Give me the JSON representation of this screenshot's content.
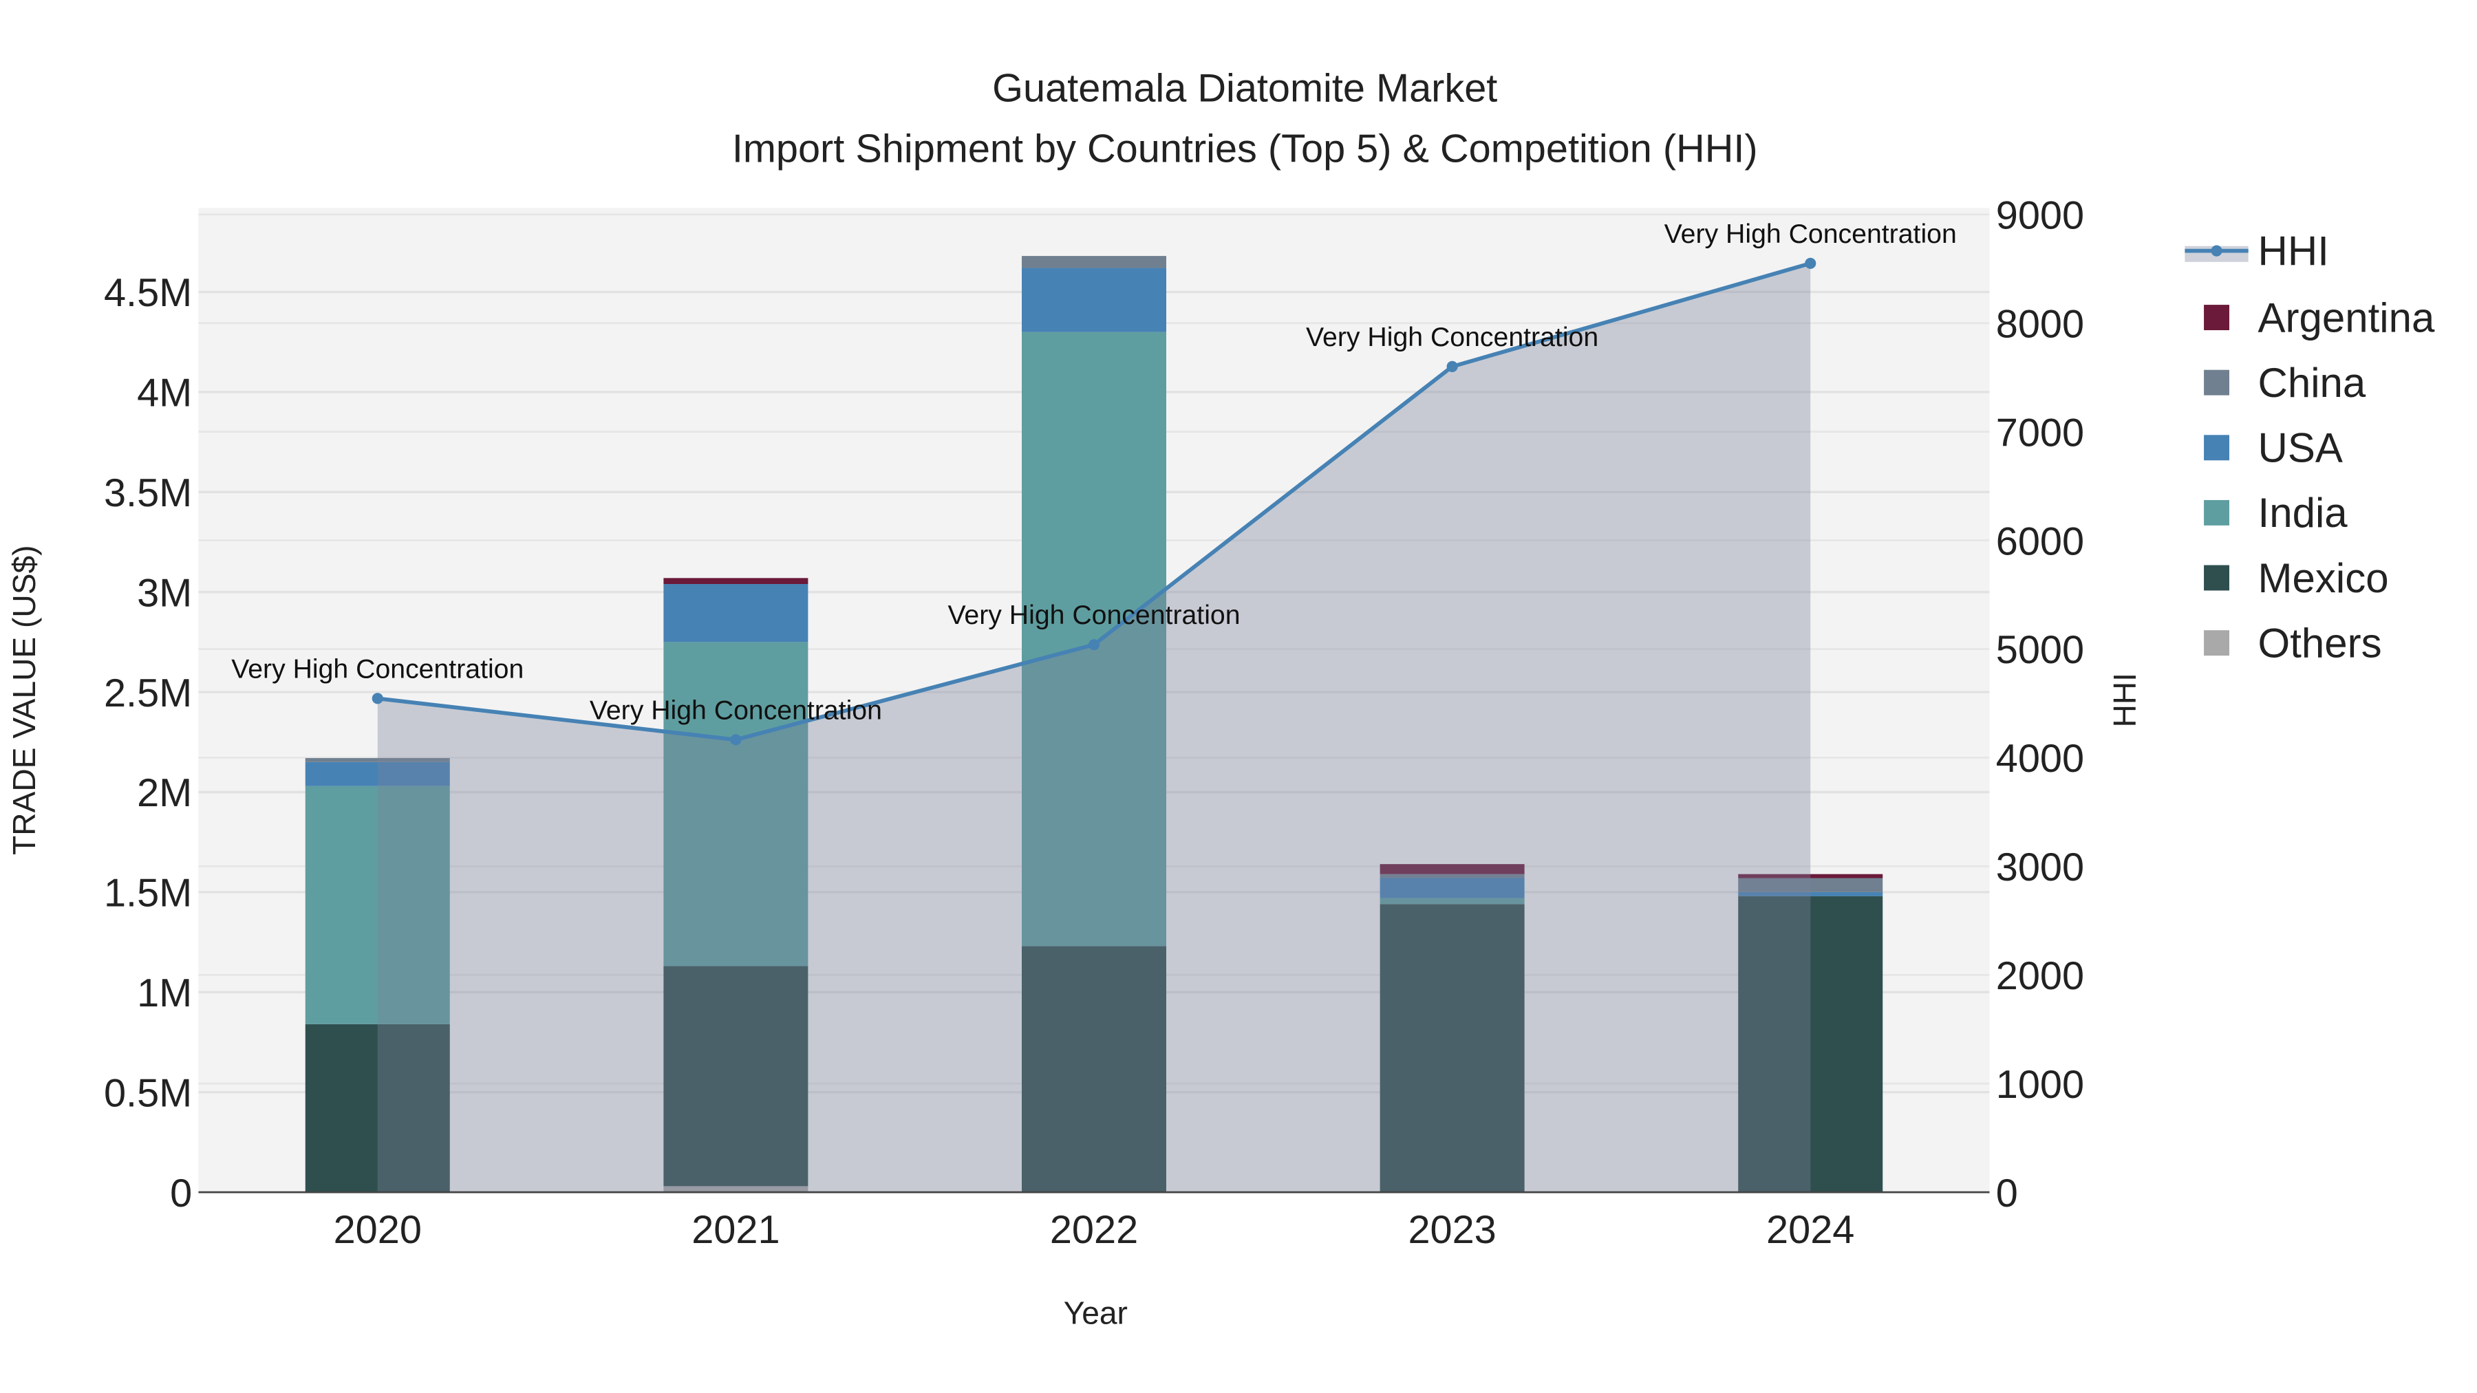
{
  "chart_data": {
    "type": "bar",
    "title_line1": "Guatemala Diatomite Market",
    "title_line2": "Import Shipment by Countries (Top 5) & Competition (HHI)",
    "xlabel": "Year",
    "ylabel": "TRADE VALUE (US$)",
    "y2label": "HHI",
    "categories": [
      "2020",
      "2021",
      "2022",
      "2023",
      "2024"
    ],
    "ylim": [
      0,
      4920000
    ],
    "y2lim": [
      0,
      9060
    ],
    "yticks": [
      0,
      500000,
      1000000,
      1500000,
      2000000,
      2500000,
      3000000,
      3500000,
      4000000,
      4500000
    ],
    "ytick_labels": [
      "0",
      "0.5M",
      "1M",
      "1.5M",
      "2M",
      "2.5M",
      "3M",
      "3.5M",
      "4M",
      "4.5M"
    ],
    "y2ticks": [
      0,
      1000,
      2000,
      3000,
      4000,
      5000,
      6000,
      7000,
      8000,
      9000
    ],
    "y2tick_labels": [
      "0",
      "1000",
      "2000",
      "3000",
      "4000",
      "5000",
      "6000",
      "7000",
      "8000",
      "9000"
    ],
    "stack_order_bottom_to_top": [
      "Others",
      "Mexico",
      "India",
      "USA",
      "China",
      "Argentina"
    ],
    "series": [
      {
        "name": "Argentina",
        "color": "#6b1a3a",
        "values": [
          0,
          30000,
          0,
          50000,
          20000
        ]
      },
      {
        "name": "China",
        "color": "#708090",
        "values": [
          20000,
          0,
          60000,
          20000,
          70000
        ]
      },
      {
        "name": "USA",
        "color": "#4682b4",
        "values": [
          120000,
          290000,
          320000,
          100000,
          20000
        ]
      },
      {
        "name": "India",
        "color": "#5f9ea0",
        "values": [
          1190000,
          1620000,
          3070000,
          30000,
          0
        ]
      },
      {
        "name": "Mexico",
        "color": "#2f4f4f",
        "values": [
          840000,
          1100000,
          1230000,
          1440000,
          1480000
        ]
      },
      {
        "name": "Others",
        "color": "#a9a9a9",
        "values": [
          0,
          30000,
          0,
          0,
          0
        ]
      }
    ],
    "line": {
      "name": "HHI",
      "color": "#4682b4",
      "values": [
        4545,
        4165,
        5040,
        7600,
        8550
      ],
      "annotations": [
        "Very High Concentration",
        "Very High Concentration",
        "Very High Concentration",
        "Very High Concentration",
        "Very High Concentration"
      ]
    },
    "legend": {
      "placement": "right",
      "entries": [
        "HHI",
        "Argentina",
        "China",
        "USA",
        "India",
        "Mexico",
        "Others"
      ]
    }
  }
}
